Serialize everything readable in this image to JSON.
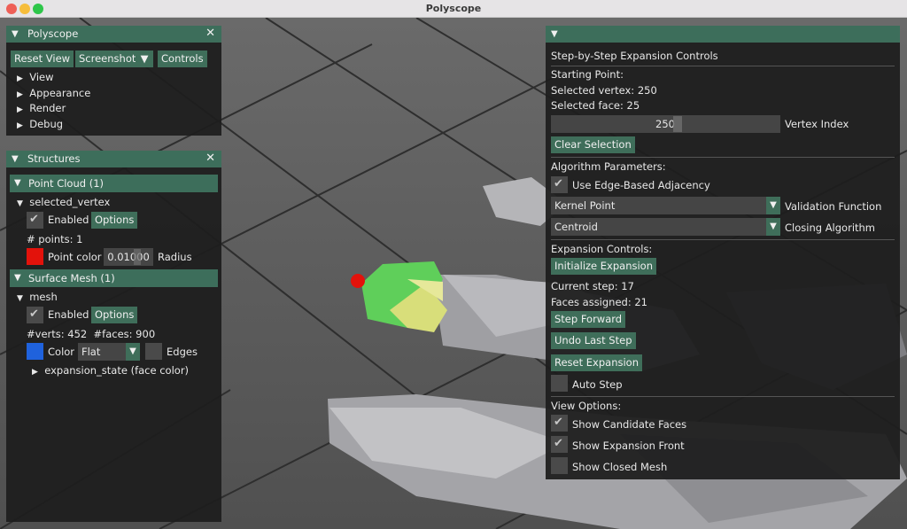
{
  "window": {
    "title": "Polyscope",
    "traffic_lights": {
      "close": "#ee5f57",
      "minimize": "#f6bd3b",
      "zoom": "#2ec64a"
    }
  },
  "colors": {
    "accent": "#3d6e5b",
    "panel_bg": "#1e1e1e",
    "point_color": "#e3120b",
    "mesh_color": "#1f62dd"
  },
  "polyscope_panel": {
    "title": "Polyscope",
    "buttons": {
      "reset_view": "Reset View",
      "screenshot": "Screenshot",
      "controls": "Controls"
    },
    "tree": [
      "View",
      "Appearance",
      "Render",
      "Debug"
    ]
  },
  "structures_panel": {
    "title": "Structures",
    "point_cloud": {
      "header": "Point Cloud (1)",
      "name": "selected_vertex",
      "enabled_label": "Enabled",
      "options_label": "Options",
      "points_info": "# points: 1",
      "point_color_label": "Point color",
      "radius_value": "0.01000",
      "radius_label": "Radius"
    },
    "surface_mesh": {
      "header": "Surface Mesh (1)",
      "name": "mesh",
      "enabled_label": "Enabled",
      "options_label": "Options",
      "info": "#verts: 452  #faces: 900",
      "color_label": "Color",
      "shading": "Flat",
      "edges_label": "Edges",
      "quantity": "expansion_state (face color)"
    }
  },
  "expansion_panel": {
    "title": "Step-by-Step Expansion Controls",
    "starting_point": {
      "heading": "Starting Point:",
      "selected_vertex": "Selected vertex: 250",
      "selected_face": "Selected face: 25",
      "vertex_index_value": "250",
      "vertex_index_label": "Vertex Index",
      "clear_selection": "Clear Selection"
    },
    "algorithm": {
      "heading": "Algorithm Parameters:",
      "edge_adjacency_label": "Use Edge-Based Adjacency",
      "validation_value": "Kernel Point",
      "validation_label": "Validation Function",
      "closing_value": "Centroid",
      "closing_label": "Closing Algorithm"
    },
    "expansion": {
      "heading": "Expansion Controls:",
      "initialize": "Initialize Expansion",
      "current_step": "Current step: 17",
      "faces_assigned": "Faces assigned: 21",
      "step_forward": "Step Forward",
      "undo_last": "Undo Last Step",
      "reset": "Reset Expansion",
      "auto_step": "Auto Step"
    },
    "view_options": {
      "heading": "View Options:",
      "show_candidate": "Show Candidate Faces",
      "show_front": "Show Expansion Front",
      "show_closed": "Show Closed Mesh"
    }
  }
}
